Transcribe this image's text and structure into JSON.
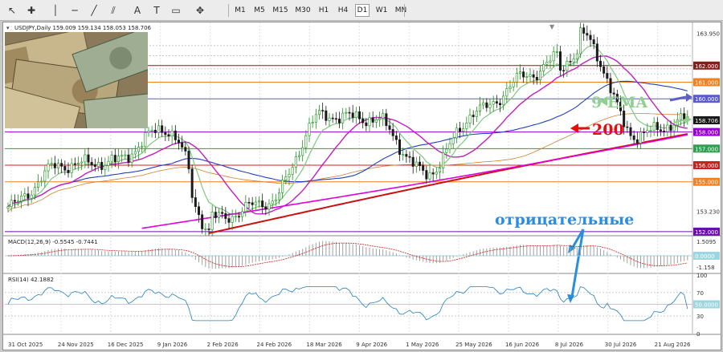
{
  "toolbar": {
    "tools": [
      "cursor-icon",
      "crosshair-icon",
      "vertical-line-icon",
      "horizontal-line-icon",
      "trendline-icon",
      "channel-icon",
      "text-icon",
      "label-icon",
      "rectangle-icon",
      "shapes-icon"
    ],
    "timeframes": [
      "M1",
      "M5",
      "M15",
      "M30",
      "H1",
      "H4",
      "D1",
      "W1",
      "MN"
    ],
    "active_timeframe": "D1"
  },
  "header": {
    "symbol": "USDJPY,Daily",
    "ohlc": "159.009 159.134 158.053 158.706"
  },
  "price_axis": {
    "labels": [
      "163.950",
      "162.000",
      "161.000",
      "160.000",
      "158.000",
      "157.000",
      "156.000",
      "155.000",
      "153.230",
      "152.000"
    ],
    "current_price": "158.706"
  },
  "levels": [
    {
      "price": 162.0,
      "label": "162.000",
      "color": "#8b1a1a"
    },
    {
      "price": 161.0,
      "label": "161.000",
      "color": "#f08020"
    },
    {
      "price": 160.0,
      "label": "160.000",
      "color": "#5a5ac8"
    },
    {
      "price": 158.0,
      "label": "158.000",
      "color": "#9400d3"
    },
    {
      "price": 157.0,
      "label": "157.000",
      "color": "#2e9e50"
    },
    {
      "price": 156.0,
      "label": "156.000",
      "color": "#cc2020"
    },
    {
      "price": 155.0,
      "label": "155.000",
      "color": "#f08020"
    },
    {
      "price": 152.0,
      "label": "152.000",
      "color": "#6a0dad"
    }
  ],
  "annotations": {
    "ema9": "9 EMA",
    "ma200": "200",
    "negative": "отрицательные"
  },
  "macd": {
    "title": "MACD(12,26,9) -0.5545 -0.7441",
    "axis": [
      "1.5095",
      "0.0000",
      "-1.158"
    ]
  },
  "rsi": {
    "title": "RSI(14) 42.1882",
    "axis": [
      "100",
      "70",
      "50.0000",
      "30",
      "0"
    ]
  },
  "dates": [
    "31 Oct 2025",
    "24 Nov 2025",
    "16 Dec 2025",
    "9 Jan 2026",
    "2 Feb 2026",
    "24 Feb 2026",
    "18 Mar 2026",
    "9 Apr 2026",
    "1 May 2026",
    "25 May 2026",
    "16 Jun 2026",
    "8 Jul 2026",
    "30 Jul 2026",
    "21 Aug 2026"
  ],
  "colors": {
    "bull": "#1a8f1a",
    "bear": "#1a1a1a",
    "ema9": "#7ec87e",
    "ma_magenta": "#c020c0",
    "ma_blue": "#2040c0",
    "ma200": "#cc1010",
    "ma_orange": "#d08030",
    "annot_green": "#8fd08f",
    "annot_red": "#e01010",
    "annot_blue": "#2a8ee0"
  },
  "chart_data": {
    "type": "line",
    "title": "USDJPY,Daily",
    "ylim": [
      151.8,
      164.5
    ],
    "x": [
      "31 Oct 2025",
      "24 Nov 2025",
      "16 Dec 2025",
      "9 Jan 2026",
      "2 Feb 2026",
      "24 Feb 2026",
      "18 Mar 2026",
      "9 Apr 2026",
      "1 May 2026",
      "25 May 2026",
      "16 Jun 2026",
      "8 Jul 2026",
      "30 Jul 2026",
      "21 Aug 2026"
    ],
    "series": [
      {
        "values": [
          153.5,
          156.0,
          156.2,
          158.2,
          152.8,
          153.8,
          159.0,
          158.8,
          155.5,
          159.3,
          161.5,
          163.8,
          157.8,
          158.7
        ]
      }
    ]
  }
}
